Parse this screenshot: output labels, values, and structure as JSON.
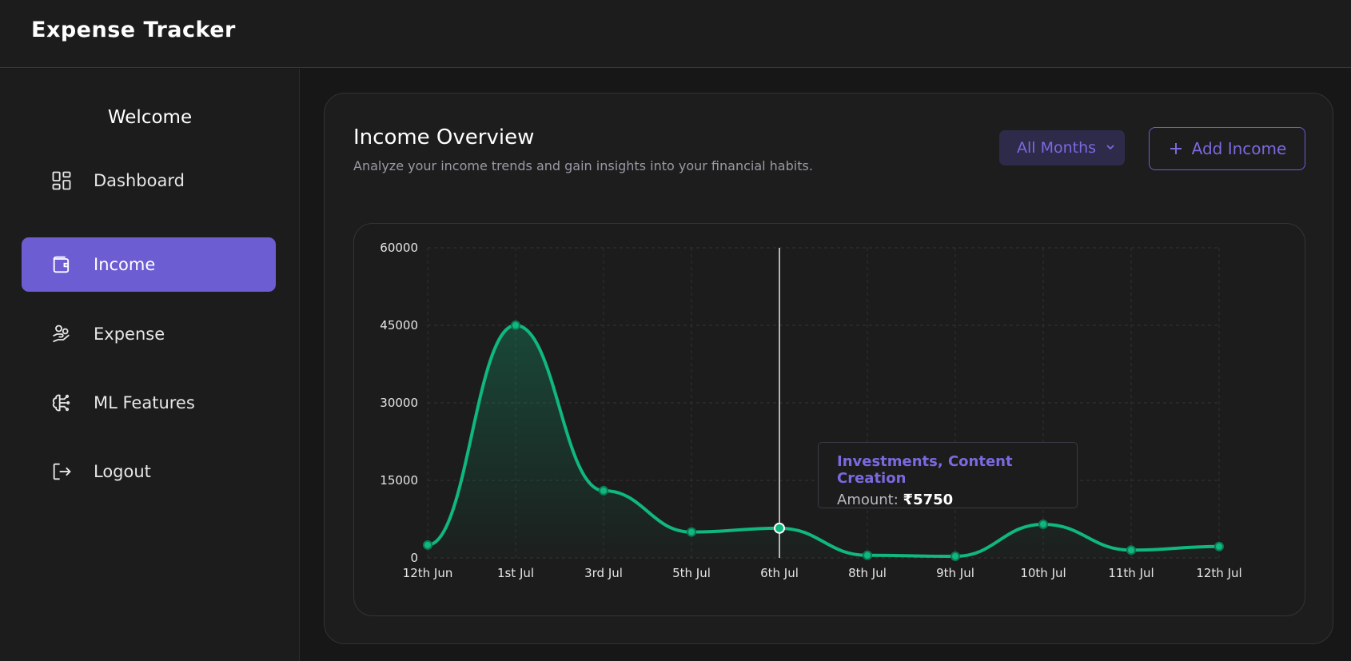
{
  "app": {
    "title": "Expense Tracker"
  },
  "sidebar": {
    "welcome": "Welcome",
    "items": [
      {
        "label": "Dashboard",
        "icon": "dashboard-icon",
        "active": false
      },
      {
        "label": "Income",
        "icon": "wallet-icon",
        "active": true
      },
      {
        "label": "Expense",
        "icon": "hand-coins-icon",
        "active": false
      },
      {
        "label": "ML Features",
        "icon": "brain-icon",
        "active": false
      },
      {
        "label": "Logout",
        "icon": "logout-icon",
        "active": false
      }
    ]
  },
  "main": {
    "title": "Income Overview",
    "subtitle": "Analyze your income trends and gain insights into your financial habits.",
    "month_filter": "All Months",
    "add_button": "Add Income"
  },
  "tooltip": {
    "title": "Investments, Content Creation",
    "amount_label": "Amount:",
    "amount_value": "₹5750"
  },
  "colors": {
    "accent": "#6c5dd3",
    "line": "#10b77f",
    "background": "#171717"
  },
  "chart_data": {
    "type": "area",
    "categories": [
      "12th Jun",
      "1st Jul",
      "3rd Jul",
      "5th Jul",
      "6th Jul",
      "8th Jul",
      "9th Jul",
      "10th Jul",
      "11th Jul",
      "12th Jul"
    ],
    "values": [
      2500,
      45000,
      13000,
      5000,
      5750,
      500,
      300,
      6500,
      1500,
      2200
    ],
    "yticks": [
      0,
      15000,
      30000,
      45000,
      60000
    ],
    "ylim": [
      0,
      60000
    ],
    "highlighted_index": 4,
    "grid": true
  }
}
